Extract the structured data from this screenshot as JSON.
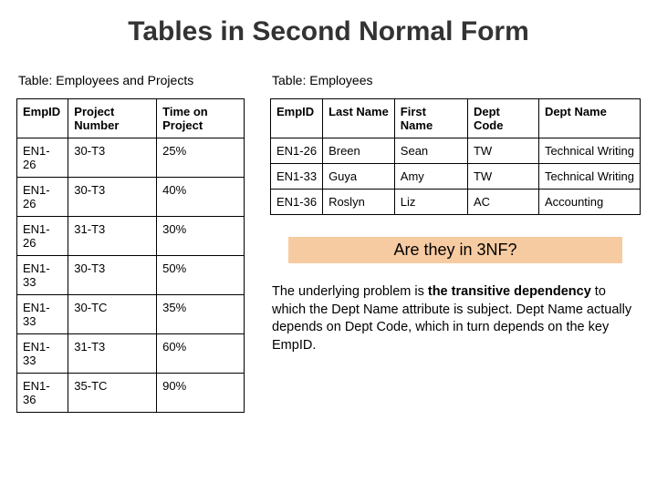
{
  "title": "Tables in Second Normal Form",
  "left": {
    "caption": "Table: Employees and Projects",
    "headers": [
      "EmpID",
      "Project Number",
      "Time on Project"
    ],
    "rows": [
      [
        "EN1-26",
        "30-T3",
        "25%"
      ],
      [
        "EN1-26",
        "30-T3",
        "40%"
      ],
      [
        "EN1-26",
        "31-T3",
        "30%"
      ],
      [
        "EN1-33",
        "30-T3",
        "50%"
      ],
      [
        "EN1-33",
        "30-TC",
        "35%"
      ],
      [
        "EN1-33",
        "31-T3",
        "60%"
      ],
      [
        "EN1-36",
        "35-TC",
        "90%"
      ]
    ]
  },
  "right": {
    "caption": "Table: Employees",
    "headers": [
      "EmpID",
      "Last Name",
      "First Name",
      "Dept Code",
      "Dept Name"
    ],
    "rows": [
      [
        "EN1-26",
        "Breen",
        "Sean",
        "TW",
        "Technical Writing"
      ],
      [
        "EN1-33",
        "Guya",
        "Amy",
        "TW",
        "Technical Writing"
      ],
      [
        "EN1-36",
        "Roslyn",
        "Liz",
        "AC",
        "Accounting"
      ]
    ]
  },
  "callout": "Are they in 3NF?",
  "paragraph_parts": {
    "p1": "The underlying problem is ",
    "b1": "the transitive dependency",
    "p2": " to which the Dept Name attribute is subject. Dept Name actually depends on Dept Code, which in turn depends on the key EmpID."
  }
}
